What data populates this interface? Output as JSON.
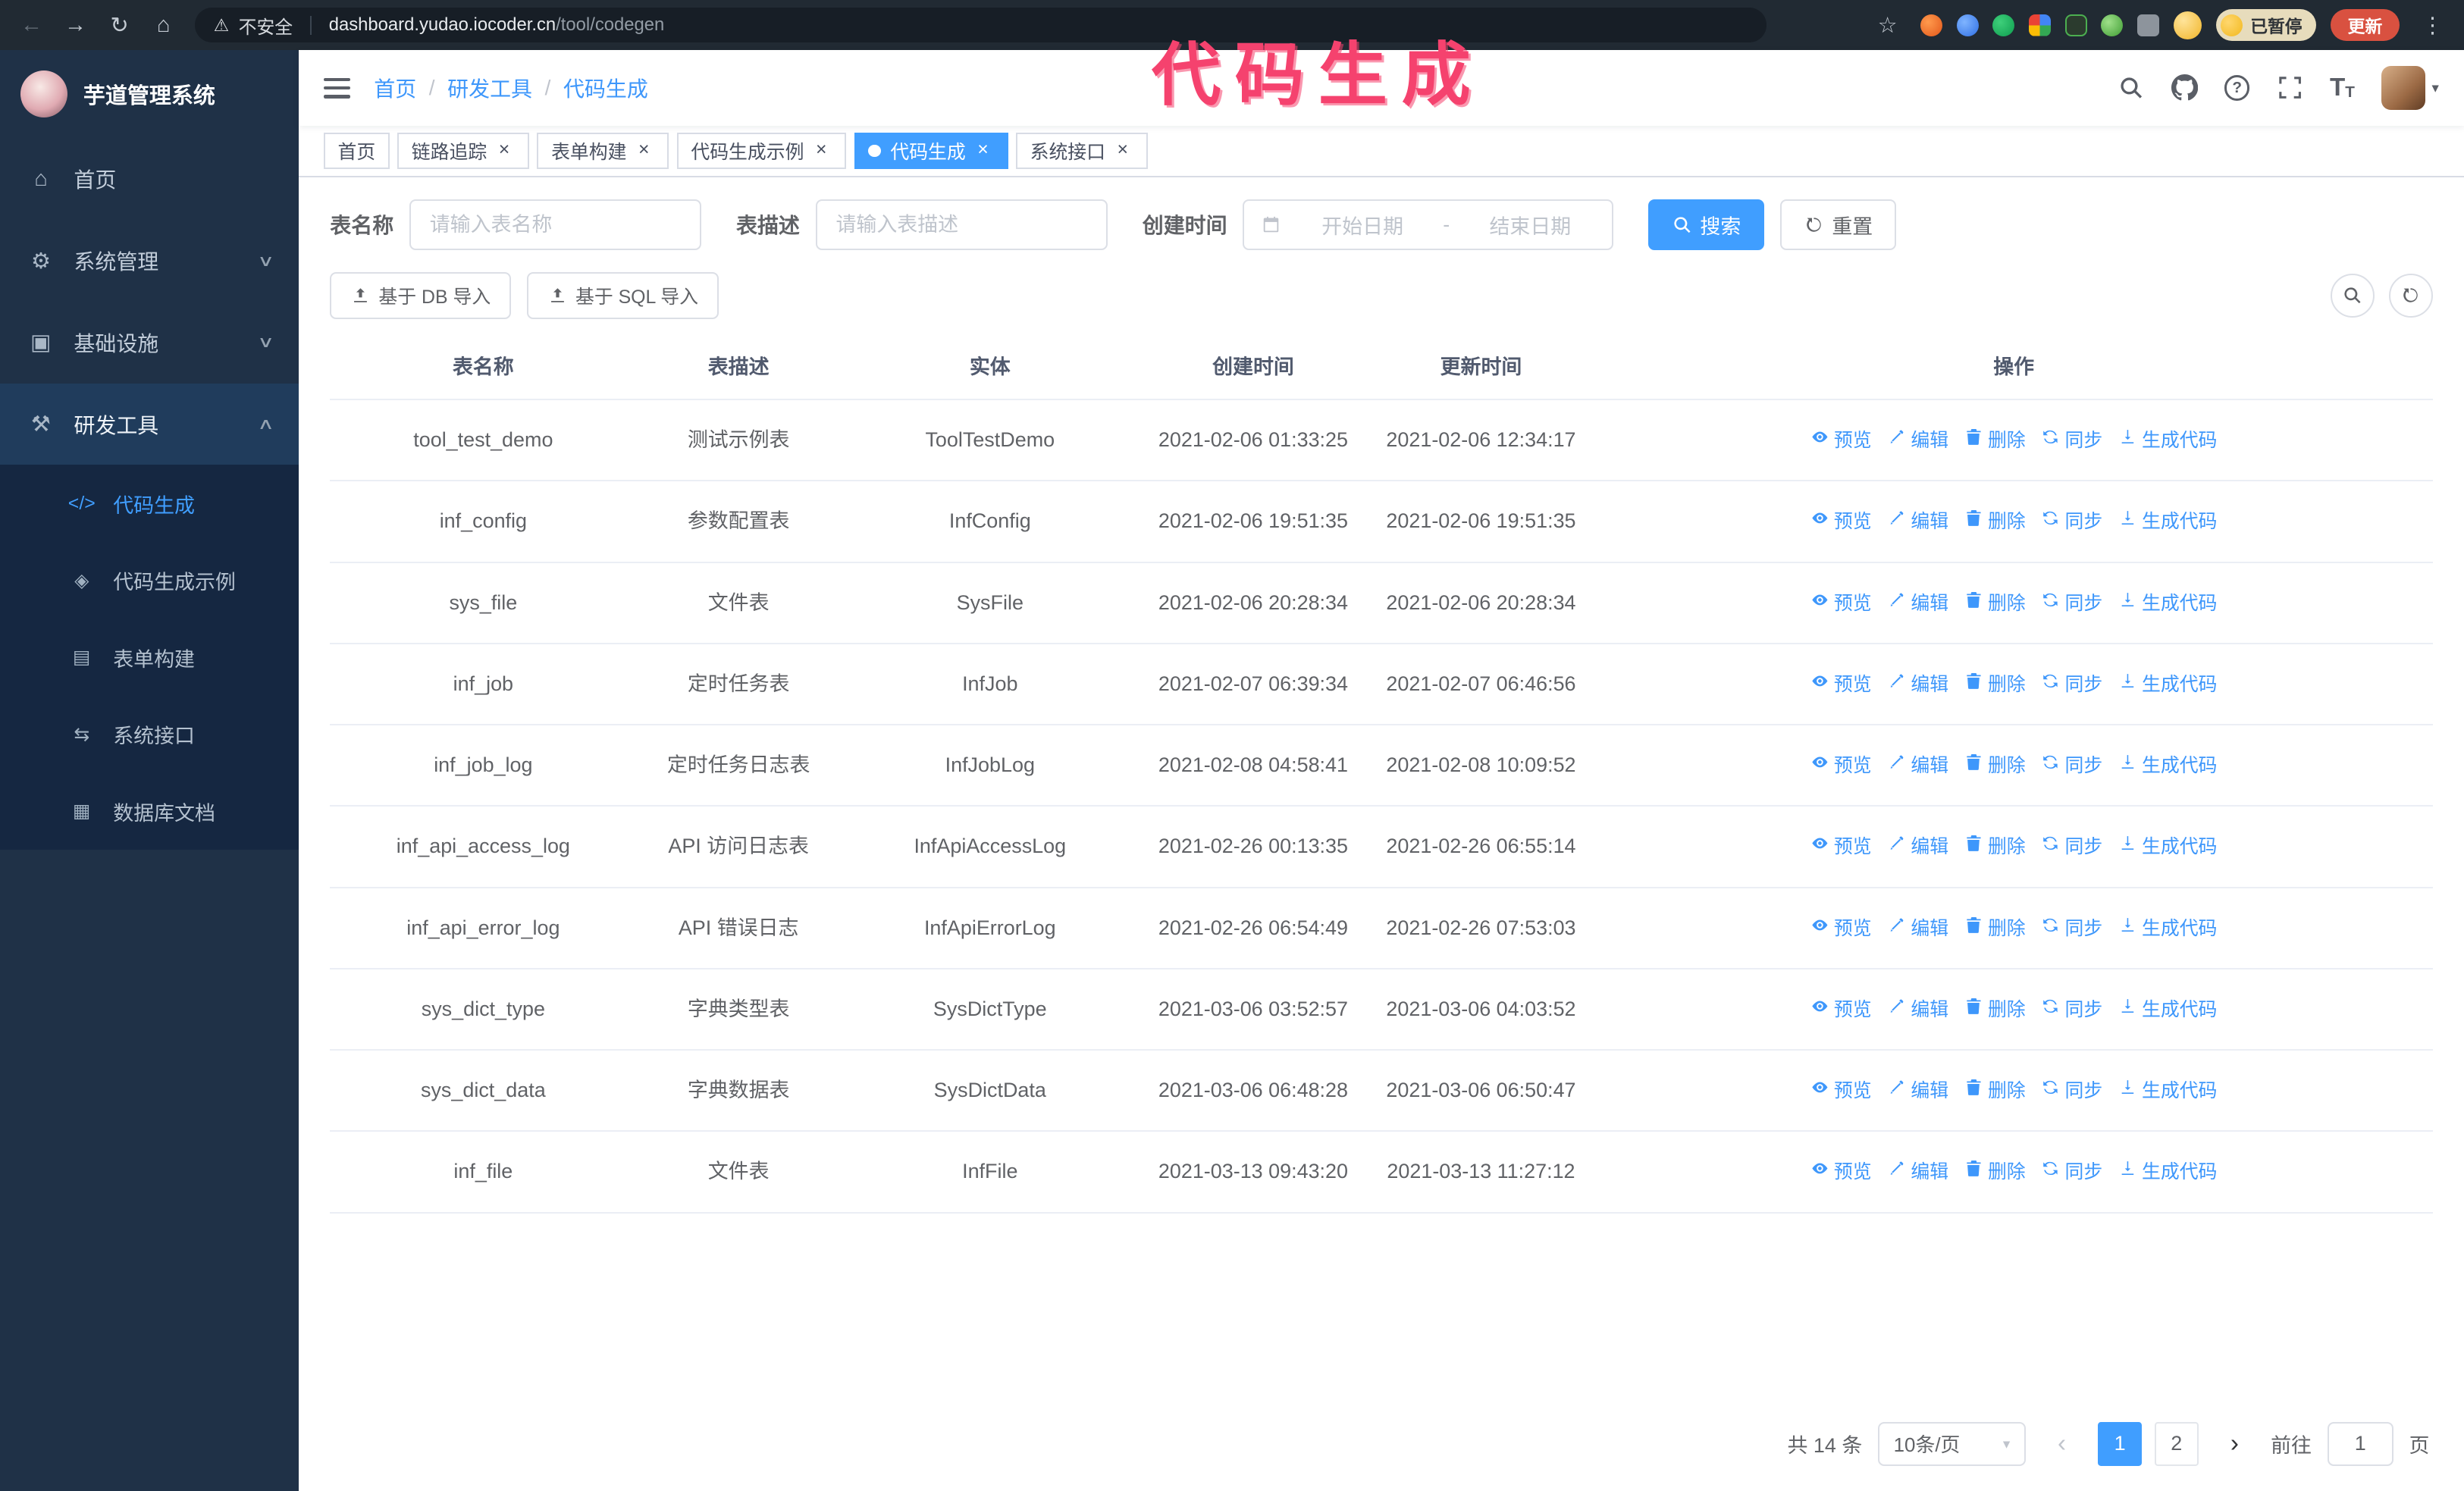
{
  "annotation": {
    "text": "代码生成"
  },
  "browser": {
    "security_label": "不安全",
    "url_host": "dashboard.yudao.iocoder.cn",
    "url_path": "/tool/codegen",
    "paused_badge": "已暂停",
    "update_button": "更新"
  },
  "app": {
    "title": "芋道管理系统"
  },
  "icons": {
    "back": "←",
    "forward": "→",
    "reload": "↻",
    "home": "⌂",
    "warning": "⚠",
    "star": "☆",
    "more": "⋮",
    "close": "×",
    "caret_down": "▾",
    "help": "?",
    "fontsize": "T",
    "chevron_up": "∧",
    "chevron_down": "∨",
    "home-icon": "⌂",
    "gear-icon": "⚙",
    "infra-icon": "▣",
    "tools-icon": "⚒",
    "code-icon": "</>",
    "example-icon": "◈",
    "form-icon": "▤",
    "api-icon": "⇆",
    "dbdoc-icon": "▦"
  },
  "sidebar": {
    "items": [
      {
        "key": "home",
        "label": "首页",
        "icon": "home-icon",
        "type": "item"
      },
      {
        "key": "system",
        "label": "系统管理",
        "icon": "gear-icon",
        "type": "group",
        "state": "collapsed"
      },
      {
        "key": "infra",
        "label": "基础设施",
        "icon": "infra-icon",
        "type": "group",
        "state": "collapsed"
      },
      {
        "key": "devtools",
        "label": "研发工具",
        "icon": "tools-icon",
        "type": "group",
        "state": "expanded",
        "children": [
          {
            "key": "codegen",
            "label": "代码生成",
            "icon": "code-icon",
            "active": true
          },
          {
            "key": "codegen-example",
            "label": "代码生成示例",
            "icon": "example-icon"
          },
          {
            "key": "form-builder",
            "label": "表单构建",
            "icon": "form-icon"
          },
          {
            "key": "system-api",
            "label": "系统接口",
            "icon": "api-icon"
          },
          {
            "key": "db-doc",
            "label": "数据库文档",
            "icon": "dbdoc-icon"
          }
        ]
      }
    ]
  },
  "header": {
    "breadcrumb": [
      "首页",
      "研发工具",
      "代码生成"
    ],
    "breadcrumb_separator": "/"
  },
  "tabs": [
    {
      "key": "home",
      "label": "首页",
      "closable": false
    },
    {
      "key": "tracer",
      "label": "链路追踪",
      "closable": true
    },
    {
      "key": "form-builder",
      "label": "表单构建",
      "closable": true
    },
    {
      "key": "codegen-example",
      "label": "代码生成示例",
      "closable": true
    },
    {
      "key": "codegen",
      "label": "代码生成",
      "closable": true,
      "active": true
    },
    {
      "key": "system-api",
      "label": "系统接口",
      "closable": true
    }
  ],
  "filters": {
    "table_name_label": "表名称",
    "table_name_placeholder": "请输入表名称",
    "table_desc_label": "表描述",
    "table_desc_placeholder": "请输入表描述",
    "create_time_label": "创建时间",
    "date_start_placeholder": "开始日期",
    "date_separator": "-",
    "date_end_placeholder": "结束日期",
    "search_button": "搜索",
    "reset_button": "重置"
  },
  "toolbar": {
    "import_db_button": "基于 DB 导入",
    "import_sql_button": "基于 SQL 导入"
  },
  "table": {
    "columns": [
      "表名称",
      "表描述",
      "实体",
      "创建时间",
      "更新时间",
      "操作"
    ],
    "actions": [
      "预览",
      "编辑",
      "删除",
      "同步",
      "生成代码"
    ],
    "rows": [
      {
        "name": "tool_test_demo",
        "desc": "测试示例表",
        "entity": "ToolTestDemo",
        "created": "2021-02-06 01:33:25",
        "updated": "2021-02-06 12:34:17"
      },
      {
        "name": "inf_config",
        "desc": "参数配置表",
        "entity": "InfConfig",
        "created": "2021-02-06 19:51:35",
        "updated": "2021-02-06 19:51:35"
      },
      {
        "name": "sys_file",
        "desc": "文件表",
        "entity": "SysFile",
        "created": "2021-02-06 20:28:34",
        "updated": "2021-02-06 20:28:34"
      },
      {
        "name": "inf_job",
        "desc": "定时任务表",
        "entity": "InfJob",
        "created": "2021-02-07 06:39:34",
        "updated": "2021-02-07 06:46:56"
      },
      {
        "name": "inf_job_log",
        "desc": "定时任务日志表",
        "entity": "InfJobLog",
        "created": "2021-02-08 04:58:41",
        "updated": "2021-02-08 10:09:52"
      },
      {
        "name": "inf_api_access_log",
        "desc": "API 访问日志表",
        "entity": "InfApiAccessLog",
        "created": "2021-02-26 00:13:35",
        "updated": "2021-02-26 06:55:14"
      },
      {
        "name": "inf_api_error_log",
        "desc": "API 错误日志",
        "entity": "InfApiErrorLog",
        "created": "2021-02-26 06:54:49",
        "updated": "2021-02-26 07:53:03"
      },
      {
        "name": "sys_dict_type",
        "desc": "字典类型表",
        "entity": "SysDictType",
        "created": "2021-03-06 03:52:57",
        "updated": "2021-03-06 04:03:52"
      },
      {
        "name": "sys_dict_data",
        "desc": "字典数据表",
        "entity": "SysDictData",
        "created": "2021-03-06 06:48:28",
        "updated": "2021-03-06 06:50:47"
      },
      {
        "name": "inf_file",
        "desc": "文件表",
        "entity": "InfFile",
        "created": "2021-03-13 09:43:20",
        "updated": "2021-03-13 11:27:12"
      }
    ]
  },
  "pagination": {
    "total_label": "共 14 条",
    "page_size": "10条/页",
    "pages": [
      "1",
      "2"
    ],
    "active_page": "1",
    "prev_icon": "‹",
    "next_icon": "›",
    "goto_label": "前往",
    "goto_value": "1",
    "goto_suffix": "页"
  }
}
